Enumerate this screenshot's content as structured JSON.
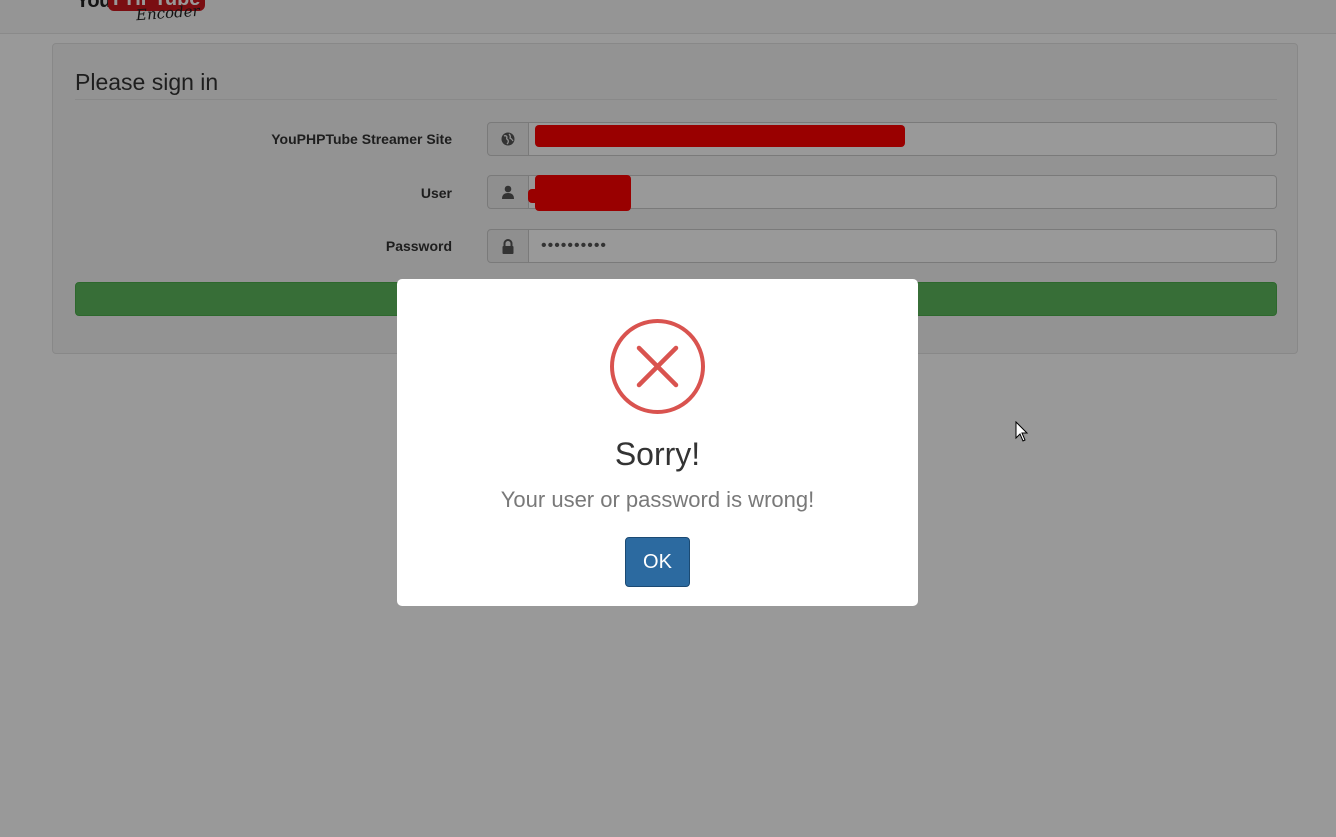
{
  "form": {
    "legend": "Please sign in",
    "fields": [
      {
        "label": "YouPHPTube Streamer Site",
        "icon": "globe-icon",
        "value": ""
      },
      {
        "label": "User",
        "icon": "user-icon",
        "value": ""
      },
      {
        "label": "Password",
        "icon": "lock-icon",
        "value": "••••••••••"
      }
    ]
  },
  "logo": {
    "you": "You",
    "php": "PHPTube",
    "encoder": "Encoder"
  },
  "dialog": {
    "title": "Sorry!",
    "message": "Your user or password is wrong!",
    "ok_label": "OK"
  },
  "colors": {
    "error_red": "#d9534f",
    "submit_green": "#5cb85c",
    "ok_blue": "#2c6aa0",
    "redaction": "#ff0000"
  }
}
